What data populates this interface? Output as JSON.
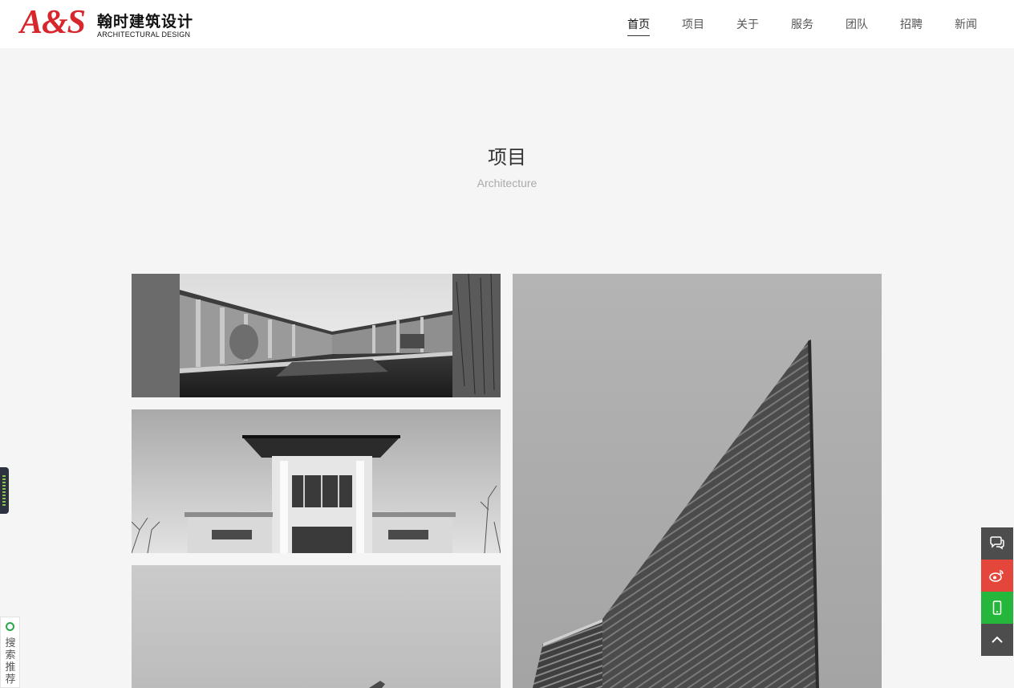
{
  "brand": {
    "mark": "A&S",
    "name_cn": "翰时建筑设计",
    "name_en": "ARCHITECTURAL DESIGN",
    "color": "#d7262c"
  },
  "nav": {
    "items": [
      {
        "label": "首页",
        "active": true
      },
      {
        "label": "项目"
      },
      {
        "label": "关于"
      },
      {
        "label": "服务"
      },
      {
        "label": "团队"
      },
      {
        "label": "招聘"
      },
      {
        "label": "新闻"
      }
    ]
  },
  "section": {
    "title": "项目",
    "subtitle": "Architecture"
  },
  "photos": [
    {
      "subject": "courtyard-reflecting-pool"
    },
    {
      "subject": "pavilion-roof-building"
    },
    {
      "subject": "building-detail"
    },
    {
      "subject": "high-rise-tower"
    }
  ],
  "side_widget": {
    "search_recommend": "搜索推荐"
  },
  "float_toolbar": {
    "buttons": [
      {
        "icon": "chat-icon",
        "color": "#4d4d4d"
      },
      {
        "icon": "weibo-icon",
        "color": "#e5463b"
      },
      {
        "icon": "mobile-icon",
        "color": "#25b73c"
      },
      {
        "icon": "back-to-top-icon",
        "color": "#4d4d4d"
      }
    ]
  }
}
